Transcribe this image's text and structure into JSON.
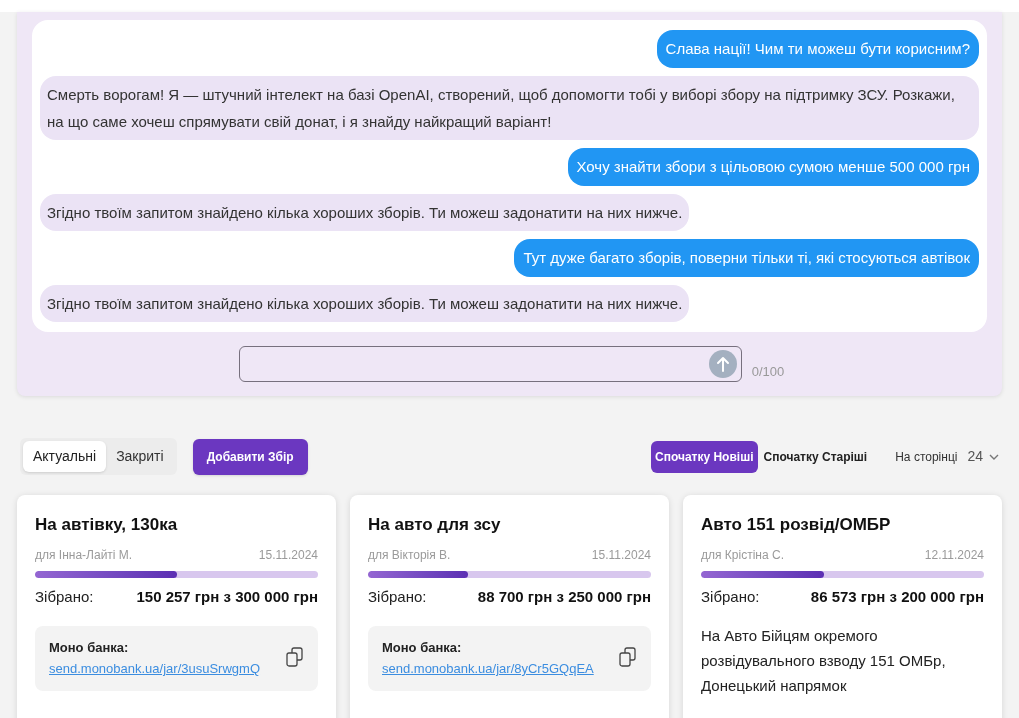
{
  "chat": {
    "messages": [
      {
        "kind": "user",
        "text": "Слава нації! Чим ти можеш бути корисним?"
      },
      {
        "kind": "bot",
        "text": "Смерть ворогам! Я — штучний інтелект на базі OpenAI, створений, щоб допомогти тобі у виборі збору на підтримку ЗСУ. Розкажи, на що саме хочеш спрямувати свій донат, і я знайду найкращий варіант!"
      },
      {
        "kind": "user",
        "text": "Хочу знайти збори з цільовою сумою менше 500 000 грн"
      },
      {
        "kind": "bot",
        "text": "Згідно твоїм запитом знайдено кілька хороших зборів. Ти можеш задонатити на них нижче."
      },
      {
        "kind": "user",
        "text": "Тут дуже багато зборів, поверни тільки ті, які стосуються автівок"
      },
      {
        "kind": "bot",
        "text": "Згідно твоїм запитом знайдено кілька хороших зборів. Ти можеш задонатити на них нижче."
      }
    ],
    "counter": "0/100"
  },
  "toolbar": {
    "tabs": [
      {
        "label": "Актуальні",
        "selected": true
      },
      {
        "label": "Закриті",
        "selected": false
      }
    ],
    "add_button": "Добавити Збір",
    "sort": [
      {
        "label": "Спочатку Новіші",
        "selected": true
      },
      {
        "label": "Спочатку Старіші",
        "selected": false
      }
    ],
    "per_page_label": "На сторінці",
    "per_page_value": "24"
  },
  "cards": [
    {
      "title": "На автівку, 130ка",
      "author": "для Інна-Лайті М.",
      "date": "15.11.2024",
      "level": 0.5,
      "collected_label": "Зібрано:",
      "amount": "150 257 грн з 300 000 грн",
      "kind": "bank",
      "bank_label": "Моно банка:",
      "link": "send.monobank.ua/jar/3usuSrwgmQ"
    },
    {
      "title": "На авто для зсу",
      "author": "для Вікторія В.",
      "date": "15.11.2024",
      "level": 0.355,
      "collected_label": "Зібрано:",
      "amount": "88 700 грн з 250 000 грн",
      "kind": "bank",
      "bank_label": "Моно банка:",
      "link": "send.monobank.ua/jar/8yCr5GQqEA"
    },
    {
      "title": "Авто 151 розвід/ОМБР",
      "author": "для Крістіна С.",
      "date": "12.11.2024",
      "level": 0.433,
      "collected_label": "Зібрано:",
      "amount": "86 573 грн з 200 000 грн",
      "kind": "description",
      "description": "На Авто Бійцям окремого розвідувального взводу 151 ОМБр, Донецький напрямок"
    }
  ]
}
